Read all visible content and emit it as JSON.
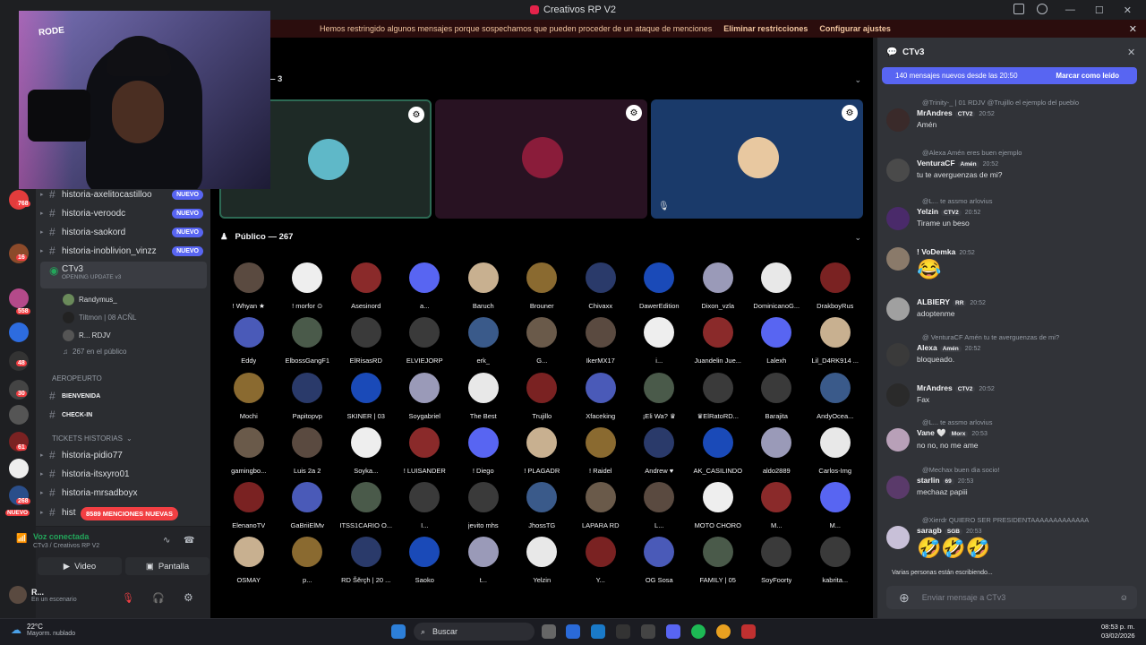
{
  "window": {
    "title": "Creativos RP V2"
  },
  "notice": {
    "text": "Hemos restringido algunos mensajes porque sospechamos que pueden proceder de un ataque de menciones",
    "remove": "Eliminar restricciones",
    "settings": "Configurar ajustes"
  },
  "guild_badges": [
    "768",
    "16",
    "558",
    "48",
    "30",
    "61",
    "268"
  ],
  "guild_nuevo": "NUEVO",
  "channels": [
    {
      "name": "historia-axelitocastilloo",
      "badge": "NUEVO"
    },
    {
      "name": "historia-veroodc",
      "badge": "NUEVO"
    },
    {
      "name": "historia-saokord",
      "badge": "NUEVO"
    },
    {
      "name": "historia-inoblivion_vinzz",
      "badge": "NUEVO"
    }
  ],
  "stage_channel": {
    "name": "CTv3",
    "subtitle": "OPENING UPDATE v3"
  },
  "voice_users": [
    {
      "name": "Randymus_"
    },
    {
      "name": "Tiltmon | 08  ACÑL"
    },
    {
      "name": "R...  RDJV"
    },
    {
      "name": "267 en el público"
    }
  ],
  "categories": {
    "aeropuerto": "AEROPEURTO",
    "bienvenida": "BIENVENIDA",
    "checkin": "CHECK-IN",
    "tickets": "TICKETS HISTORIAS"
  },
  "ticket_channels": [
    "historia-pidio77",
    "historia-itsxyro01",
    "historia-mrsadboyx",
    "hist"
  ],
  "mention_pill": "8589 MENCIONES NUEVAS",
  "voice_panel": {
    "title": "Voz conectada",
    "subtitle": "CTv3 / Creativos RP V2",
    "video": "Video",
    "screen": "Pantalla"
  },
  "user": {
    "name": "R...",
    "status": "En un escenario"
  },
  "stage": {
    "speakers_header": "s — 3",
    "public_header": "Público — 267"
  },
  "members": [
    "! Whyan ★",
    "! morfor ⊙",
    "Asesinord",
    "a...",
    "Baruch",
    "Brouner",
    "Chivaxx",
    "DawerEdition",
    "Dixon_vzla",
    "DominicanoG...",
    "DrakboyRus",
    "Eddy",
    "ElbossGangF1",
    "ElRisasRD",
    "ELVIEJORP",
    "erk_",
    "G...",
    "IkerMX17",
    "i...",
    "Juandelin Jue...",
    "Lalexh",
    "Lil_D4RK914 ...",
    "Mochi",
    "Papitopvp",
    "SKINER | 03",
    "Soygabriel",
    "The Best",
    "Trujillo",
    "Xfaceking",
    "¡Eli Wa? ♛",
    "♛ElRatoRD...",
    "Barajita",
    "AndyOcea...",
    "gamingbo...",
    "Luis 2a 2",
    "Soyka...",
    "! LUISANDER",
    "! Diego",
    "! PLAGADR",
    "! Raidel",
    "Andrew ♥",
    "AK_CASILINDO",
    "aldo2889",
    "Carlos-Img",
    "ElenanoTV",
    "GaBriiElMv",
    "ITSS1CARIO O...",
    "I...",
    "jevito mhs",
    "JhossTG",
    "LAPARA RD",
    "L...",
    "MOTO CHORO",
    "M...",
    "M...",
    "OSMAY",
    "p...",
    "RD Šěrçh | 20 ...",
    "Saoko",
    "t...",
    "Yelzin",
    "Y...",
    "OG Sosa",
    "FAMILY | 05",
    "SoyFoorty",
    "kabrita..."
  ],
  "chat": {
    "title": "CTv3",
    "new_messages": "140 mensajes nuevos desde las 20:50",
    "mark_read": "Marcar como leído",
    "messages": [
      {
        "reply": "@Trinity-_ | 01  RDJV  @Trujillo el ejemplo del pueblo",
        "author": "MrAndres",
        "tag": "CTV2",
        "time": "20:52",
        "text": "Amén"
      },
      {
        "reply": "@Alexa  Amén  eres buen ejemplo",
        "author": "VenturaCF",
        "tag": "Amén",
        "time": "20:52",
        "text": "tu te averguenzas de mi?"
      },
      {
        "reply": "@L... te assmo arlovius",
        "author": "Yelzin",
        "tag": "CTV2",
        "time": "20:52",
        "text": "Tirame un beso"
      },
      {
        "reply": "",
        "author": "! VoDemka",
        "tag": "",
        "time": "20:52",
        "text": "😂"
      },
      {
        "reply": "",
        "author": "ALBIERY",
        "tag": "RR",
        "time": "20:52",
        "text": "adoptenme"
      },
      {
        "reply": "@ VenturaCF  Amén  tu te averguenzas de mi?",
        "author": "Alexa",
        "tag": "Amén",
        "time": "20:52",
        "text": "bloqueado."
      },
      {
        "reply": "",
        "author": "MrAndres",
        "tag": "CTV2",
        "time": "20:52",
        "text": "Fax"
      },
      {
        "reply": "@L... te assmo arlovius",
        "author": "Vane 🤍",
        "tag": "Morx",
        "time": "20:53",
        "text": "no no, no me ame"
      },
      {
        "reply": "@Mechax buen dia socio!",
        "author": "starlin",
        "tag": "69",
        "time": "20:53",
        "text": "mechaaz papiii"
      },
      {
        "reply": "@Xierdr QUIERO SER PRESIDENTAAAAAAAAAAAAA",
        "author": "saragb",
        "tag": "SGB",
        "time": "20:53",
        "text": "🤣🤣🤣"
      }
    ],
    "typing": "Varias personas están escribiendo...",
    "input_placeholder": "Enviar mensaje a CTv3"
  },
  "taskbar": {
    "temp": "22°C",
    "weather": "Mayorm. nublado",
    "search": "Buscar",
    "time": "08:53 p. m.",
    "date": "03/02/2026"
  },
  "webcam": {
    "brand": "RODE"
  }
}
